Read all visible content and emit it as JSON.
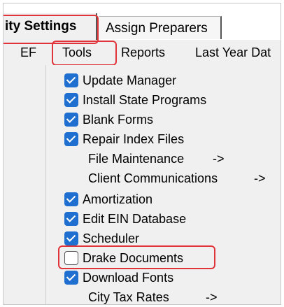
{
  "tabs": [
    {
      "label": "ity Settings",
      "active": true
    },
    {
      "label": "Assign Preparers",
      "active": false
    }
  ],
  "menubar": {
    "items": [
      "EF",
      "Tools",
      "Reports",
      "Last Year Dat"
    ]
  },
  "tools_menu": {
    "items": [
      {
        "label": "Update Manager",
        "checked": true
      },
      {
        "label": "Install State Programs",
        "checked": true
      },
      {
        "label": "Blank Forms",
        "checked": true
      },
      {
        "label": "Repair Index Files",
        "checked": true
      },
      {
        "label": "File Maintenance",
        "submenu_arrow": "->"
      },
      {
        "label": "Client Communications",
        "submenu_arrow": "->"
      },
      {
        "label": "Amortization",
        "checked": true
      },
      {
        "label": "Edit EIN Database",
        "checked": true
      },
      {
        "label": "Scheduler",
        "checked": true
      },
      {
        "label": "Drake Documents",
        "checked": false
      },
      {
        "label": "Download Fonts",
        "checked": true
      },
      {
        "label": "City Tax Rates",
        "submenu_arrow": "->"
      }
    ]
  },
  "colors": {
    "highlight": "#e0343a",
    "checkbox": "#1f6fd1"
  }
}
